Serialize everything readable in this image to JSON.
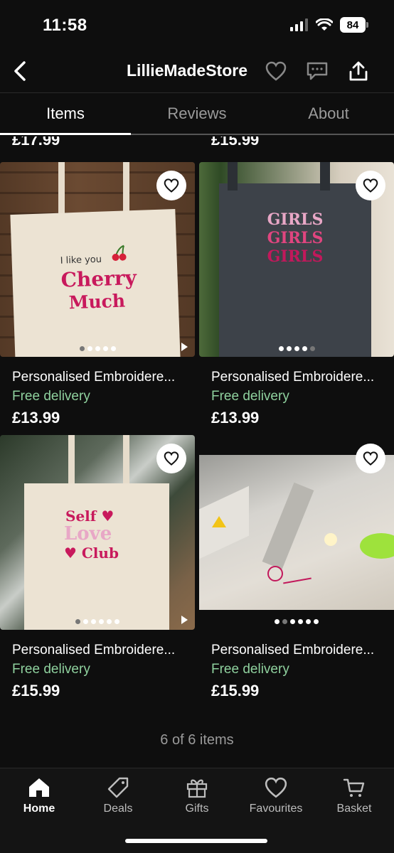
{
  "status": {
    "time": "11:58",
    "battery": "84"
  },
  "header": {
    "title": "LillieMadeStore"
  },
  "tabs": [
    {
      "label": "Items",
      "active": true
    },
    {
      "label": "Reviews",
      "active": false
    },
    {
      "label": "About",
      "active": false
    }
  ],
  "partial_prices": [
    "£17.99",
    "£15.99"
  ],
  "products": [
    {
      "title": "Personalised Embroidere...",
      "delivery": "Free delivery",
      "price": "£13.99",
      "image_text": [
        "I like you",
        "Cherry",
        "Much"
      ]
    },
    {
      "title": "Personalised Embroidere...",
      "delivery": "Free delivery",
      "price": "£13.99",
      "image_text": [
        "GIRLS",
        "GIRLS",
        "GIRLS"
      ]
    },
    {
      "title": "Personalised Embroidere...",
      "delivery": "Free delivery",
      "price": "£15.99",
      "image_text": [
        "Self ♥",
        "Love",
        "♥ Club"
      ]
    },
    {
      "title": "Personalised Embroidere...",
      "delivery": "Free delivery",
      "price": "£15.99"
    }
  ],
  "items_count": "6 of 6 items",
  "bottom_nav": [
    {
      "label": "Home",
      "icon": "home-icon",
      "active": true
    },
    {
      "label": "Deals",
      "icon": "tag-icon",
      "active": false
    },
    {
      "label": "Gifts",
      "icon": "gift-icon",
      "active": false
    },
    {
      "label": "Favourites",
      "icon": "heart-icon",
      "active": false
    },
    {
      "label": "Basket",
      "icon": "cart-icon",
      "active": false
    }
  ],
  "colors": {
    "background": "#0e0e0e",
    "delivery": "#8fd19e",
    "cherry": "#c8195c",
    "pink": "#e8a7c6"
  }
}
